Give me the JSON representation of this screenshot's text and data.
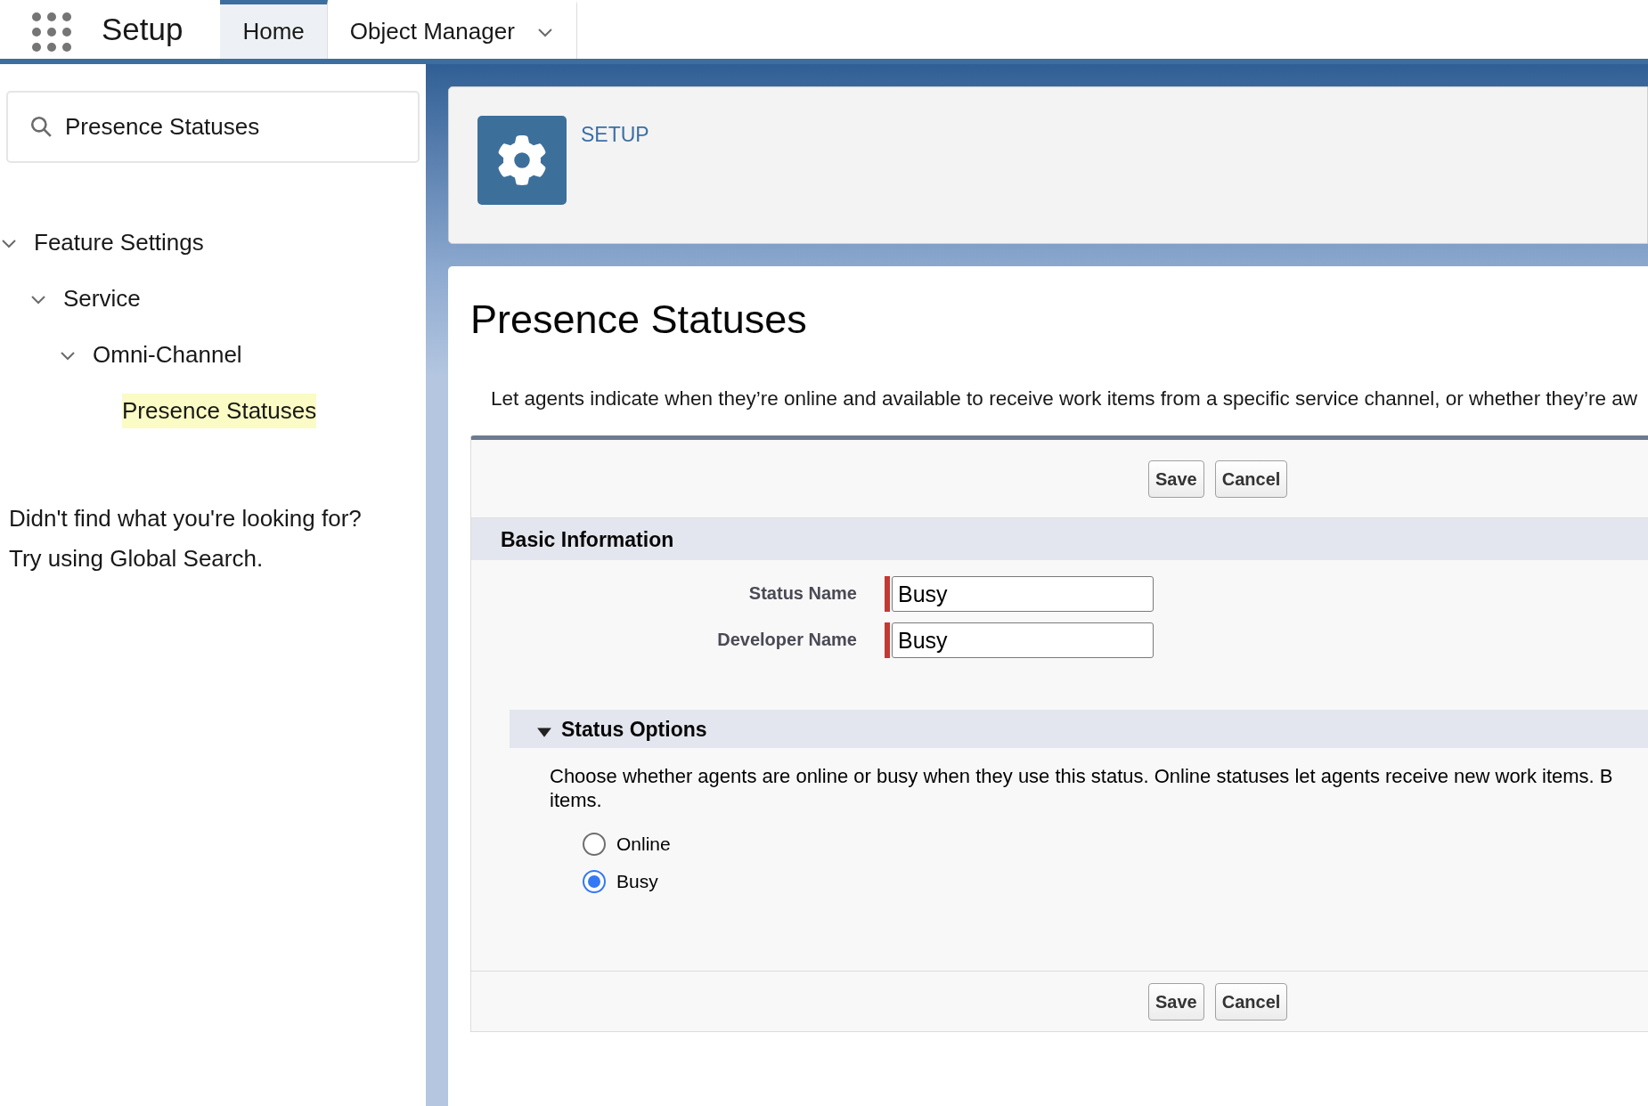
{
  "header": {
    "app_name": "Setup",
    "tabs": [
      {
        "label": "Home",
        "selected": true,
        "has_menu": false
      },
      {
        "label": "Object Manager",
        "selected": false,
        "has_menu": true
      }
    ]
  },
  "sidebar": {
    "search": {
      "value": "Presence Statuses"
    },
    "tree": [
      {
        "label": "Feature Settings",
        "expanded": true,
        "children": [
          {
            "label": "Service",
            "expanded": true,
            "children": [
              {
                "label": "Omni-Channel",
                "expanded": true,
                "children": [
                  {
                    "label": "Presence Statuses",
                    "selected": true
                  }
                ]
              }
            ]
          }
        ]
      }
    ],
    "help_lines": [
      "Didn't find what you're looking for?",
      "Try using Global Search."
    ]
  },
  "page_header": {
    "eyebrow": "SETUP"
  },
  "main": {
    "title": "Presence Statuses",
    "description": "Let agents indicate when they’re online and available to receive work items from a specific service channel, or whether they’re aw",
    "top_buttons": [
      "Save",
      "Cancel"
    ],
    "basic_information": {
      "title": "Basic Information",
      "fields": [
        {
          "label": "Status Name",
          "value": "Busy",
          "required": true
        },
        {
          "label": "Developer Name",
          "value": "Busy",
          "required": true
        }
      ]
    },
    "status_options": {
      "title": "Status Options",
      "expanded": true,
      "description_lines": [
        "Choose whether agents are online or busy when they use this status. Online statuses let agents receive new work items. B",
        "items."
      ],
      "options": [
        {
          "label": "Online",
          "selected": false
        },
        {
          "label": "Busy",
          "selected": true
        }
      ]
    },
    "bottom_buttons": [
      "Save",
      "Cancel"
    ]
  }
}
